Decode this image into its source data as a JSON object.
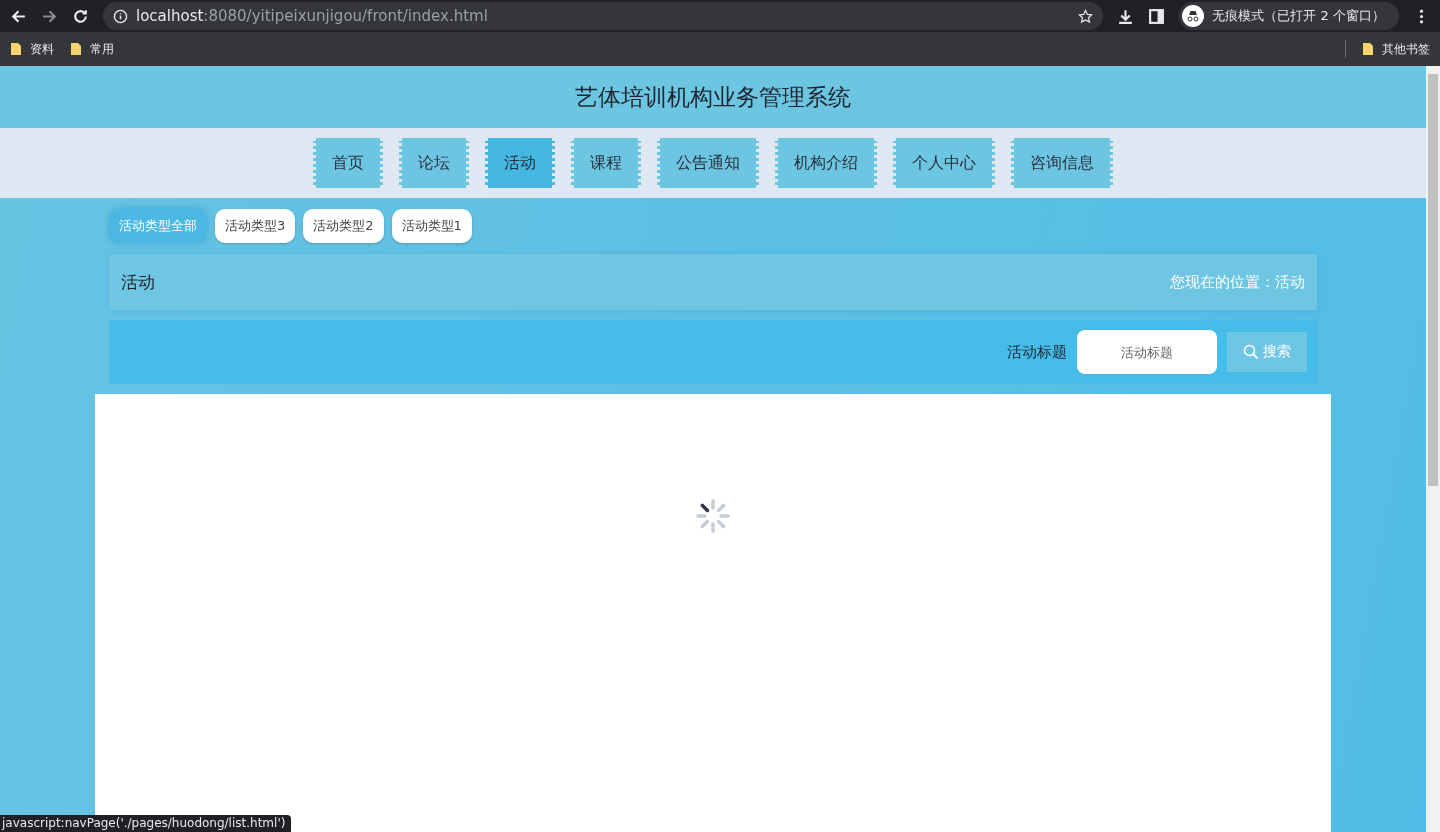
{
  "browser": {
    "url_host": "localhost",
    "url_path": ":8080/yitipeixunjigou/front/index.html",
    "incognito": "无痕模式（已打开 2 个窗口）",
    "bookmarks": [
      {
        "label": "资料"
      },
      {
        "label": "常用"
      }
    ],
    "other_bookmarks": "其他书签"
  },
  "site": {
    "title": "艺体培训机构业务管理系统",
    "nav": [
      {
        "label": "首页",
        "selected": false
      },
      {
        "label": "论坛",
        "selected": false
      },
      {
        "label": "活动",
        "selected": true
      },
      {
        "label": "课程",
        "selected": false
      },
      {
        "label": "公告通知",
        "selected": false
      },
      {
        "label": "机构介绍",
        "selected": false
      },
      {
        "label": "个人中心",
        "selected": false
      },
      {
        "label": "咨询信息",
        "selected": false
      }
    ]
  },
  "categories": [
    {
      "label": "活动类型全部",
      "selected": true
    },
    {
      "label": "活动类型3",
      "selected": false
    },
    {
      "label": "活动类型2",
      "selected": false
    },
    {
      "label": "活动类型1",
      "selected": false
    }
  ],
  "breadcrumb": {
    "title": "活动",
    "location": "您现在的位置：活动"
  },
  "search": {
    "label": "活动标题",
    "placeholder": "活动标题",
    "button": "搜索"
  },
  "status_bar": "javascript:navPage('./pages/huodong/list.html')"
}
